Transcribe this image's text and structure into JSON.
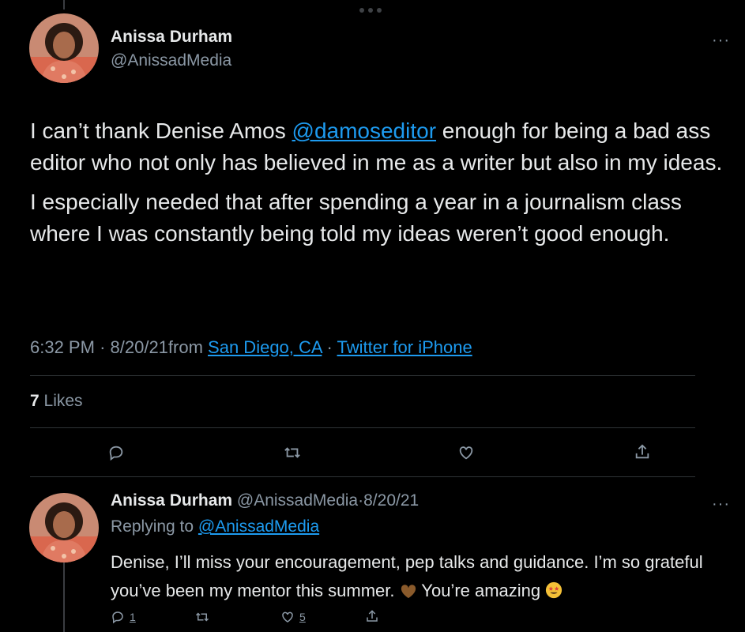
{
  "main_tweet": {
    "author_name": "Anissa Durham",
    "author_handle": "@AnissadMedia",
    "text_part1": "I can’t thank Denise Amos ",
    "mention": "@damoseditor",
    "text_part2": " enough for being a bad ass editor who not only has believed in me as a writer but also in my ideas.",
    "text_para2": "I especially needed that after spending a year in a journalism class where I was constantly being told my ideas weren’t good enough.",
    "time": "6:32 PM",
    "date": "8/20/21",
    "from_label": "from",
    "location": "San Diego, CA",
    "source": "Twitter for iPhone",
    "likes_count": "7",
    "likes_label": "Likes"
  },
  "reply_tweet": {
    "author_name": "Anissa Durham",
    "author_handle": "@AnissadMedia",
    "date": "8/20/21",
    "replying_label": "Replying to",
    "replying_handle": "@AnissadMedia",
    "text_part1": "Denise, I’ll miss your encouragement, pep talks and guidance. I’m so grateful you’ve been my mentor this summer. ",
    "text_part2": " You’re amazing ",
    "reply_count": "1",
    "retweet_count": "",
    "like_count": "5"
  },
  "more_glyph": "···",
  "separator": "·",
  "colors": {
    "background": "#000000",
    "text": "#e7e9ea",
    "muted": "#8b98a5",
    "link": "#1d9bf0",
    "divider": "#2f3336"
  },
  "icons": {
    "reply": "reply-icon",
    "retweet": "retweet-icon",
    "like": "heart-icon",
    "share": "share-icon"
  }
}
